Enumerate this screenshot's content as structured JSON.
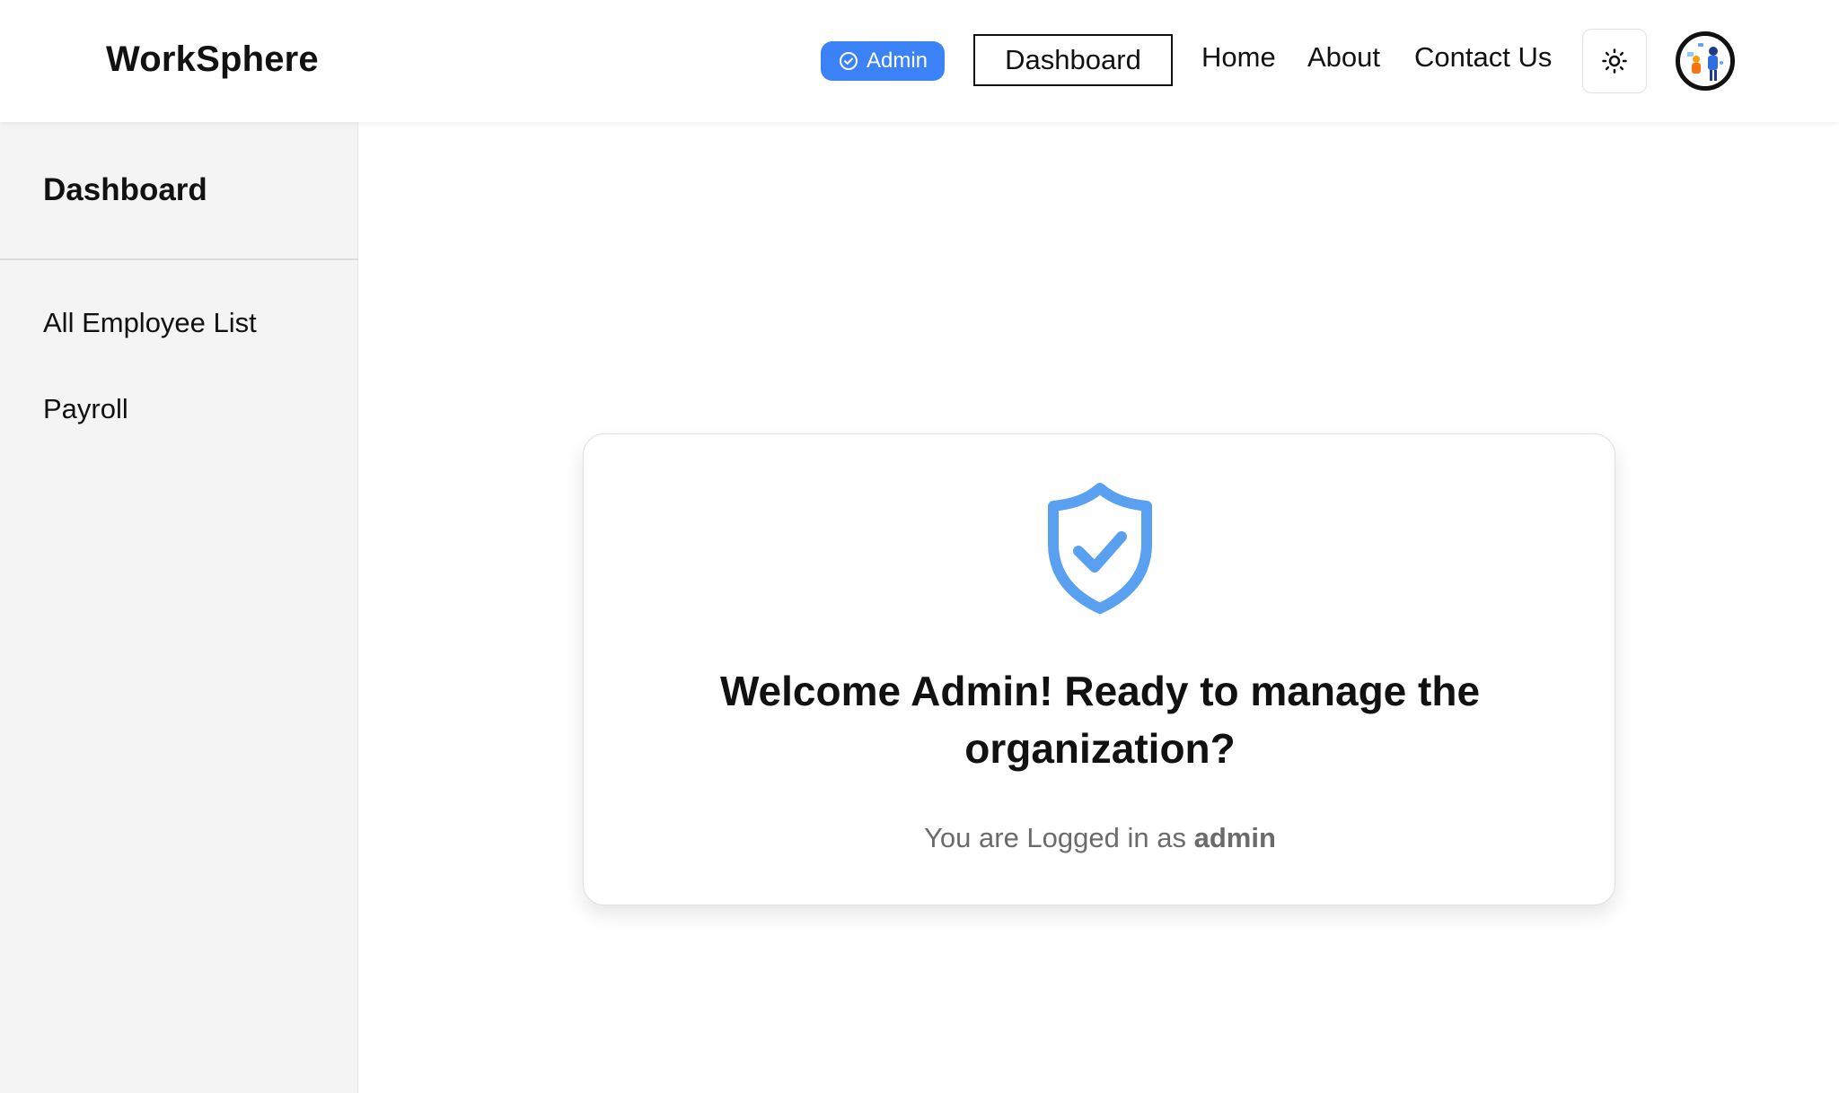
{
  "app": {
    "brand": "WorkSphere"
  },
  "header": {
    "role_badge": "Admin",
    "dashboard_button": "Dashboard",
    "nav_links": [
      "Home",
      "About",
      "Contact Us"
    ],
    "theme_toggle_icon": "sun-icon",
    "avatar_icon": "user-avatar"
  },
  "sidebar": {
    "title": "Dashboard",
    "items": [
      {
        "label": "All Employee List"
      },
      {
        "label": "Payroll"
      }
    ]
  },
  "welcome_card": {
    "icon": "shield-check-icon",
    "title": "Welcome Admin! Ready to manage the organization?",
    "subtitle_prefix": "You are Logged in as",
    "username": "admin"
  },
  "colors": {
    "accent": "#3b82f6",
    "shield": "#5aa0f0",
    "sidebar_bg": "#f4f4f4",
    "text_muted": "#6b6b6b"
  }
}
